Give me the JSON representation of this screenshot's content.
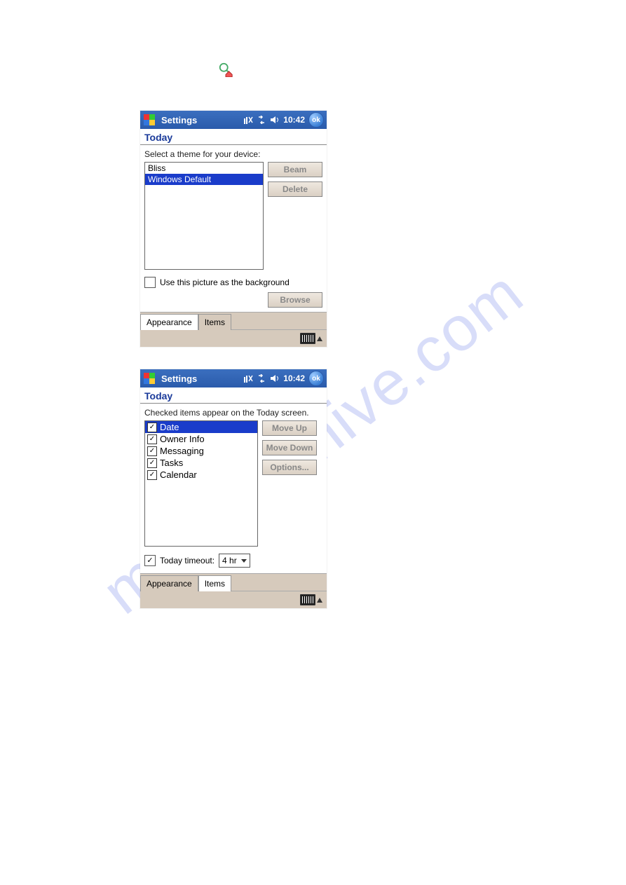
{
  "screen1": {
    "title": "Settings",
    "time": "10:42",
    "ok": "ok",
    "section": "Today",
    "prompt": "Select a theme for your device:",
    "themes": {
      "item0": "Bliss",
      "item1": "Windows Default"
    },
    "btnBeam": "Beam",
    "btnDelete": "Delete",
    "chkLabel": "Use this picture as the background",
    "btnBrowse": "Browse",
    "tabAppearance": "Appearance",
    "tabItems": "Items"
  },
  "screen2": {
    "title": "Settings",
    "time": "10:42",
    "ok": "ok",
    "section": "Today",
    "prompt": "Checked items appear on the Today screen.",
    "items": {
      "i0": "Date",
      "i1": "Owner Info",
      "i2": "Messaging",
      "i3": "Tasks",
      "i4": "Calendar"
    },
    "btnMoveUp": "Move Up",
    "btnMoveDown": "Move Down",
    "btnOptions": "Options...",
    "chkTimeout": "Today timeout:",
    "timeoutValue": "4 hr",
    "tabAppearance": "Appearance",
    "tabItems": "Items"
  },
  "watermark": "manualchive.com"
}
